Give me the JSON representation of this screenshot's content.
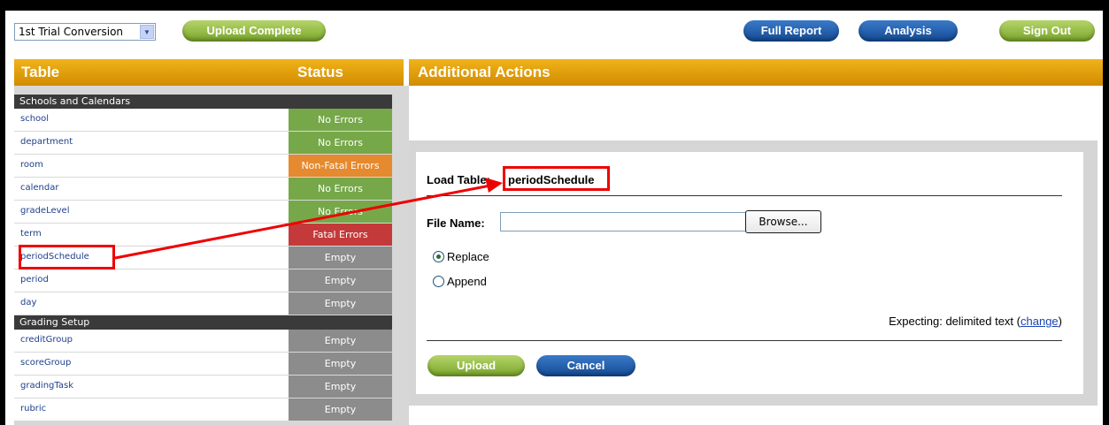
{
  "topbar": {
    "trial_select": "1st Trial Conversion",
    "upload_complete_label": "Upload Complete",
    "full_report_label": "Full Report",
    "analysis_label": "Analysis",
    "sign_out_label": "Sign Out"
  },
  "headers": {
    "table": "Table",
    "status": "Status",
    "actions": "Additional Actions"
  },
  "groups": {
    "schools": "Schools and Calendars",
    "grading": "Grading Setup"
  },
  "rows": [
    {
      "name": "school",
      "status": "No Errors"
    },
    {
      "name": "department",
      "status": "No Errors"
    },
    {
      "name": "room",
      "status": "Non-Fatal Errors"
    },
    {
      "name": "calendar",
      "status": "No Errors"
    },
    {
      "name": "gradeLevel",
      "status": "No Errors"
    },
    {
      "name": "term",
      "status": "Fatal Errors"
    },
    {
      "name": "periodSchedule",
      "status": "Empty"
    },
    {
      "name": "period",
      "status": "Empty"
    },
    {
      "name": "day",
      "status": "Empty"
    },
    {
      "name": "creditGroup",
      "status": "Empty"
    },
    {
      "name": "scoreGroup",
      "status": "Empty"
    },
    {
      "name": "gradingTask",
      "status": "Empty"
    },
    {
      "name": "rubric",
      "status": "Empty"
    }
  ],
  "form": {
    "load_table_label": "Load Table:",
    "load_table_value": "periodSchedule",
    "file_name_label": "File Name:",
    "file_name_value": "",
    "browse_label": "Browse...",
    "replace_label": "Replace",
    "append_label": "Append",
    "expecting_text": "Expecting: delimited text (",
    "change_link": "change",
    "expecting_close": ")",
    "upload_label": "Upload",
    "cancel_label": "Cancel"
  },
  "colors": {
    "header_orange": "#e6a310",
    "no_errors": "#76a84a",
    "non_fatal": "#e58a2e",
    "fatal": "#c43a3a",
    "empty": "#8c8c8c",
    "highlight_red": "#e00000"
  }
}
